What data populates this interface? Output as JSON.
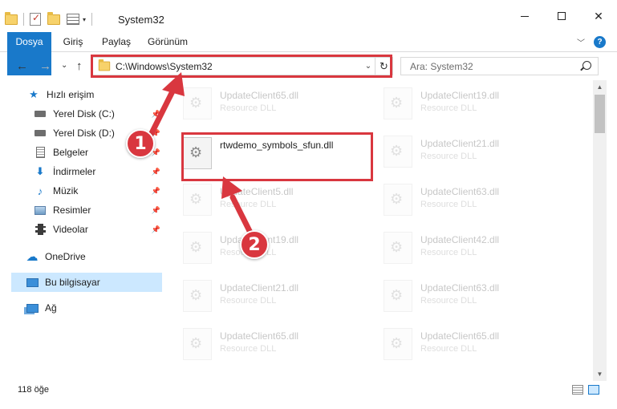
{
  "window": {
    "title": "System32",
    "minimize": "—",
    "maximize": "☐",
    "close": "✕"
  },
  "ribbon": {
    "tabs": [
      "Dosya",
      "Giriş",
      "Paylaş",
      "Görünüm"
    ],
    "collapse_icon": "chevron-up-icon",
    "help": "?"
  },
  "nav": {
    "back": "←",
    "forward": "→",
    "recent": "⌄",
    "up": "↑",
    "address": "C:\\Windows\\System32",
    "search_placeholder": "Ara: System32"
  },
  "sidebar": {
    "items": [
      {
        "label": "Hızlı erişim",
        "icon": "star-icon",
        "pinned": false
      },
      {
        "label": "Yerel Disk (C:)",
        "icon": "drive-icon",
        "pinned": true
      },
      {
        "label": "Yerel Disk (D:)",
        "icon": "drive-icon",
        "pinned": true
      },
      {
        "label": "Belgeler",
        "icon": "documents-icon",
        "pinned": true
      },
      {
        "label": "İndirmeler",
        "icon": "download-icon",
        "pinned": true
      },
      {
        "label": "Müzik",
        "icon": "music-icon",
        "pinned": true
      },
      {
        "label": "Resimler",
        "icon": "pictures-icon",
        "pinned": true
      },
      {
        "label": "Videolar",
        "icon": "video-icon",
        "pinned": true
      },
      {
        "label": "OneDrive",
        "icon": "cloud-icon",
        "pinned": false
      },
      {
        "label": "Bu bilgisayar",
        "icon": "computer-icon",
        "pinned": false
      },
      {
        "label": "Ağ",
        "icon": "network-icon",
        "pinned": false
      }
    ]
  },
  "files": {
    "highlighted": {
      "name": "rtwdemo_symbols_sfun.dll",
      "type": ""
    },
    "left_column": [
      {
        "name": "UpdateClient65.dll",
        "type": "Resource DLL"
      },
      {
        "name": "UpdateClient5.dll",
        "type": "Resource DLL"
      },
      {
        "name": "UpdateClient19.dll",
        "type": "Resource DLL"
      },
      {
        "name": "UpdateClient21.dll",
        "type": "Resource DLL"
      },
      {
        "name": "UpdateClient65.dll",
        "type": "Resource DLL"
      }
    ],
    "right_column": [
      {
        "name": "UpdateClient19.dll",
        "type": "Resource DLL"
      },
      {
        "name": "UpdateClient21.dll",
        "type": "Resource DLL"
      },
      {
        "name": "UpdateClient63.dll",
        "type": "Resource DLL"
      },
      {
        "name": "UpdateClient42.dll",
        "type": "Resource DLL"
      },
      {
        "name": "UpdateClient63.dll",
        "type": "Resource DLL"
      },
      {
        "name": "UpdateClient65.dll",
        "type": "Resource DLL"
      }
    ]
  },
  "status": {
    "count": "118 öğe"
  },
  "annotations": {
    "step1": "1",
    "step2": "2",
    "color": "#d9373f"
  }
}
